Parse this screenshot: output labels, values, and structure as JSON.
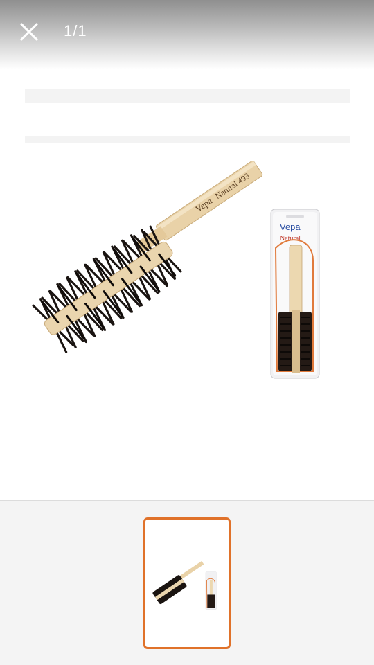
{
  "viewer": {
    "counter": "1/1",
    "close_icon": "close-icon",
    "current_index": 1,
    "total": 1
  },
  "product": {
    "brush_imprint_brand": "Vepa",
    "brush_imprint_model": "Natural 493",
    "package_brand": "Vepa",
    "package_label": "Natural"
  },
  "colors": {
    "thumb_border": "#e0722a",
    "top_bar": "#8f8f8f",
    "thumb_strip_bg": "#f4f4f4"
  }
}
